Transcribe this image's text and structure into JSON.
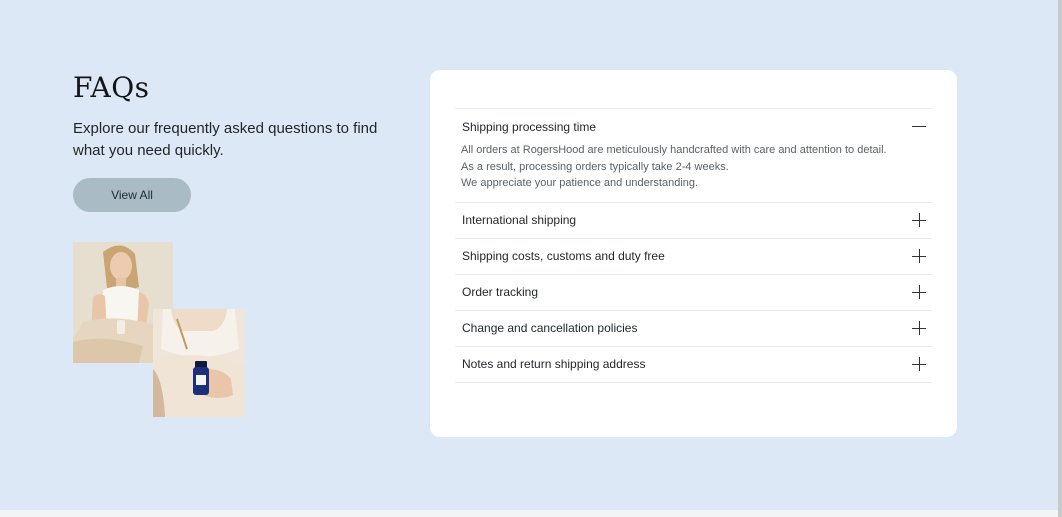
{
  "faq_section": {
    "title": "FAQs",
    "intro": "Explore our frequently asked questions to find what you need quickly.",
    "view_all_label": "View All"
  },
  "faq_items": [
    {
      "question": "Shipping processing time",
      "expanded": true,
      "toggle_icon": "minus-icon",
      "answer_lines": [
        "All orders at RogersHood are meticulously handcrafted with care and attention to detail.",
        "As a result, processing orders typically take 2-4 weeks.",
        "We appreciate your patience and understanding."
      ]
    },
    {
      "question": "International shipping",
      "expanded": false,
      "toggle_icon": "plus-icon"
    },
    {
      "question": "Shipping costs, customs and duty free",
      "expanded": false,
      "toggle_icon": "plus-icon"
    },
    {
      "question": "Order tracking",
      "expanded": false,
      "toggle_icon": "plus-icon"
    },
    {
      "question": "Change and cancellation policies",
      "expanded": false,
      "toggle_icon": "plus-icon"
    },
    {
      "question": "Notes and return shipping address",
      "expanded": false,
      "toggle_icon": "plus-icon"
    }
  ],
  "colors": {
    "background": "#dce8f5",
    "card": "#ffffff",
    "button": "#a9bcc6",
    "text": "#1f2528",
    "muted_text": "#5b6166"
  }
}
